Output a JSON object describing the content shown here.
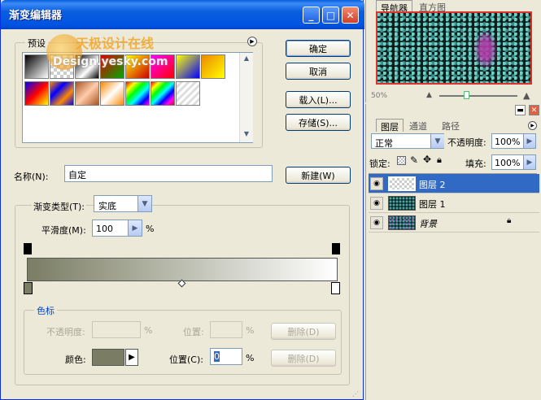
{
  "dialog": {
    "title": "渐变编辑器",
    "presets_label": "预设",
    "watermark_cn": "天极设计在线",
    "watermark_en": "Design.yesky.com",
    "ok": "确定",
    "cancel": "取消",
    "load": "载入(L)...",
    "save": "存储(S)...",
    "name_label": "名称(N):",
    "name_value": "自定",
    "new_button": "新建(W)",
    "gradient_type_label": "渐变类型(T):",
    "gradient_type_value": "实底",
    "smoothness_label": "平滑度(M):",
    "smoothness_value": "100",
    "percent": "%",
    "stops_label": "色标",
    "opacity_label": "不透明度:",
    "position_label": "位置:",
    "delete_label": "删除(D)",
    "color_label": "颜色:",
    "position2_label": "位置(C):",
    "position2_value": "0",
    "colors": {
      "start": "#7a7d63",
      "end": "#ffffff"
    }
  },
  "navigator": {
    "tabs": [
      "导航器",
      "直方图"
    ],
    "zoom": "50%"
  },
  "layers": {
    "tabs": [
      "图层",
      "通道",
      "路径"
    ],
    "blend_mode": "正常",
    "opacity_label": "不透明度:",
    "opacity_value": "100%",
    "lock_label": "锁定:",
    "fill_label": "填充:",
    "fill_value": "100%",
    "items": [
      {
        "name": "图层 2"
      },
      {
        "name": "图层 1"
      },
      {
        "name": "背景"
      }
    ]
  }
}
